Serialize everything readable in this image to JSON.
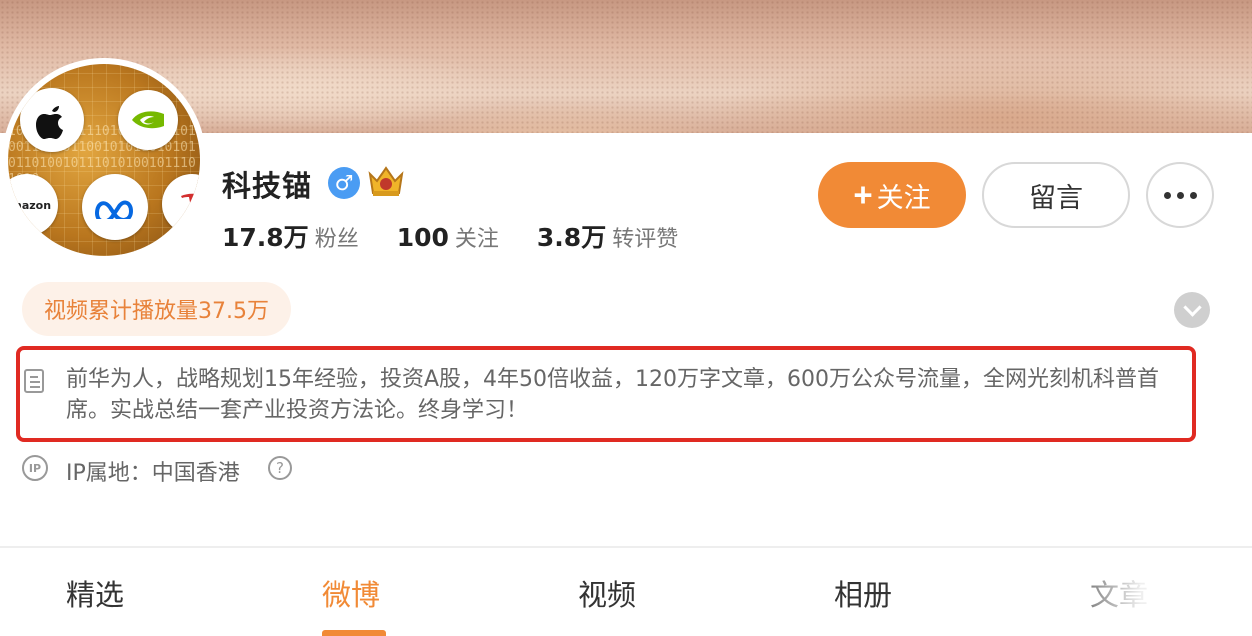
{
  "profile": {
    "username": "科技锚",
    "gender_icon": "male-icon",
    "badge_icon": "crown-icon",
    "avatar_logos": [
      "apple-logo",
      "nvidia-logo",
      "amazon-logo",
      "meta-logo",
      "tesla-logo"
    ],
    "avatar_logo_text": "amazon"
  },
  "stats": [
    {
      "value": "17.8万",
      "label": "粉丝"
    },
    {
      "value": "100",
      "label": "关注"
    },
    {
      "value": "3.8万",
      "label": "转评赞"
    }
  ],
  "actions": {
    "follow_plus": "+",
    "follow_label": "关注",
    "message_label": "留言"
  },
  "video_badge": "视频累计播放量37.5万",
  "bio": "前华为人，战略规划15年经验，投资A股，4年50倍收益，120万字文章，600万公众号流量，全网光刻机科普首席。实战总结一套产业投资方法论。终身学习！",
  "ip": {
    "icon_text": "IP",
    "text": "IP属地：中国香港",
    "help_text": "?"
  },
  "tabs": [
    {
      "label": "精选"
    },
    {
      "label": "微博"
    },
    {
      "label": "视频"
    },
    {
      "label": "相册"
    },
    {
      "label": "文章"
    }
  ],
  "active_tab": "微博",
  "colors": {
    "accent": "#f18a36",
    "highlight_box": "#e02a22",
    "gender": "#4a9cf3"
  }
}
